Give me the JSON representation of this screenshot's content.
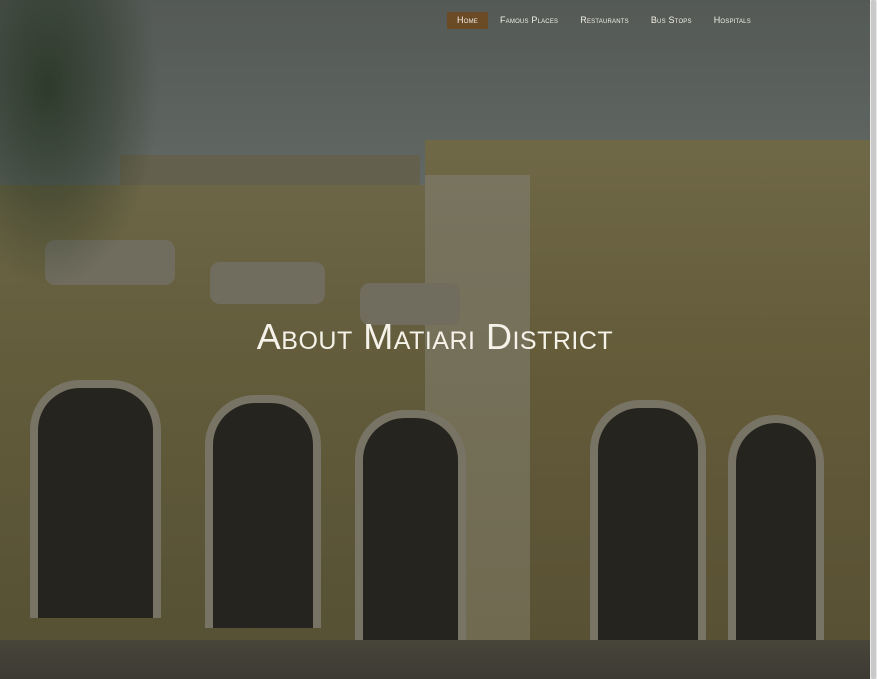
{
  "nav": {
    "items": [
      {
        "label": "Home",
        "active": true
      },
      {
        "label": "Famous Places",
        "active": false
      },
      {
        "label": "Restaurants",
        "active": false
      },
      {
        "label": "Bus Stops",
        "active": false
      },
      {
        "label": "Hospitals",
        "active": false
      }
    ],
    "active_color": "#6b4a26"
  },
  "hero": {
    "title": "About Matiari District",
    "background_description_colors": {
      "tint": "#7a7046"
    }
  }
}
